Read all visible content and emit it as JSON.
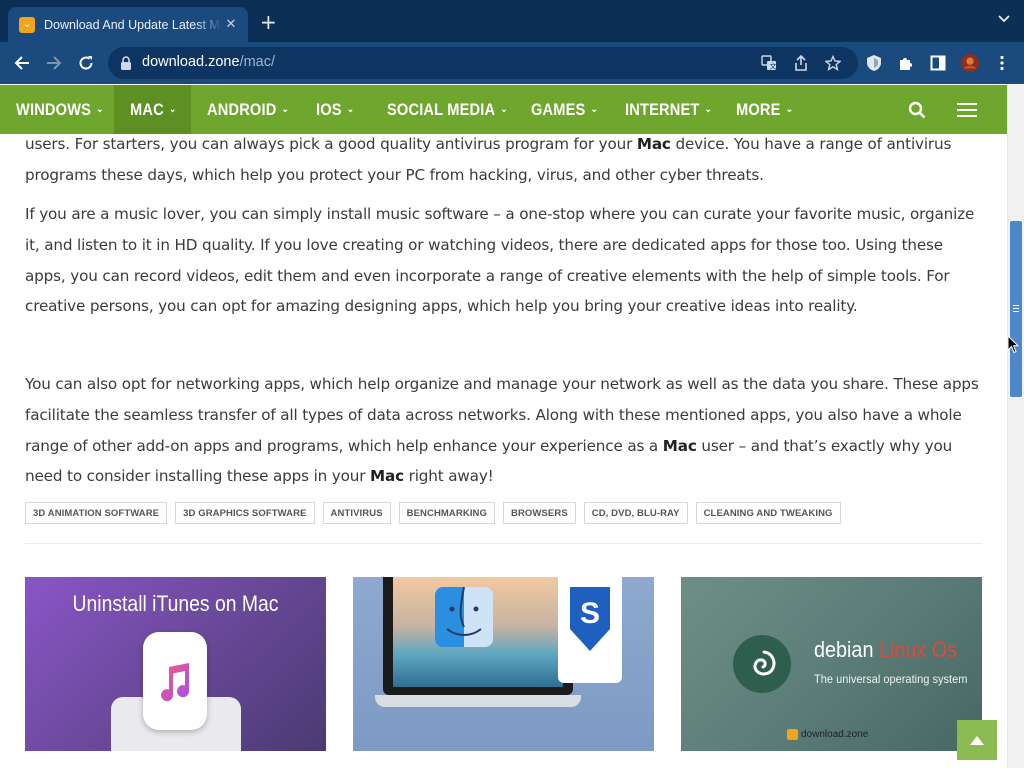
{
  "browser": {
    "tab_title": "Download And Update Latest Mac",
    "tab_close": "✕",
    "new_tab": "+",
    "url_host": "download.zone",
    "url_path": "/mac/"
  },
  "nav": {
    "items": [
      {
        "label": "WINDOWS"
      },
      {
        "label": "MAC"
      },
      {
        "label": "ANDROID"
      },
      {
        "label": "IOS"
      },
      {
        "label": "SOCIAL MEDIA"
      },
      {
        "label": "GAMES"
      },
      {
        "label": "INTERNET"
      },
      {
        "label": "MORE"
      }
    ],
    "active": "MAC"
  },
  "article": {
    "p1_a": "users. For starters, you can always pick a good quality antivirus program for your ",
    "p1_b": "Mac",
    "p1_c": " device. You have a range of antivirus programs these days, which help you protect your PC from hacking, virus, and other cyber threats.",
    "p2": "If you are a music lover, you can simply install music software – a one-stop where you can curate your favorite music, organize it, and listen to it in HD quality. If you love creating or watching videos, there are dedicated apps for those too. Using these apps, you can record videos, edit them and even incorporate a range of creative elements with the help of simple tools. For creative persons, you can opt for amazing designing apps, which help you bring your creative ideas into reality.",
    "p3_a": "You can also opt for networking apps, which help organize and manage your network as well as the data you share. These apps facilitate the seamless transfer of all types of data across networks. Along with these mentioned apps, you also have a whole range of other add-on apps and programs, which help enhance your experience as a ",
    "p3_b": "Mac",
    "p3_c": " user – and that’s exactly why you need to consider installing these apps in your ",
    "p3_d": "Mac",
    "p3_e": " right away!"
  },
  "tags": [
    "3D ANIMATION SOFTWARE",
    "3D GRAPHICS SOFTWARE",
    "ANTIVIRUS",
    "BENCHMARKING",
    "BROWSERS",
    "CD, DVD, BLU-RAY",
    "CLEANING AND TWEAKING"
  ],
  "cards": {
    "c1_title": "Uninstall iTunes on Mac",
    "c3_title_a": "debian ",
    "c3_title_b": "Linux Os",
    "c3_sub": "The universal operating system",
    "c3_brand": "download.zone"
  },
  "colors": {
    "nav_green": "#6fa62d",
    "chrome_blue": "#1a4a7e",
    "scroll_thumb": "#4f88c9"
  }
}
